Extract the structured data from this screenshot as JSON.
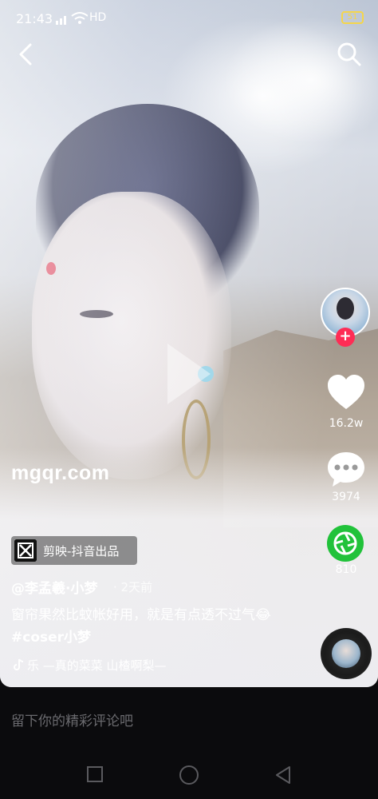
{
  "status_bar": {
    "time": "21:43",
    "network": "HD",
    "battery": "51"
  },
  "watermark": "mgqr.com",
  "capcut": {
    "label": "剪映-抖音出品"
  },
  "post": {
    "author": "@李孟羲·小梦",
    "time_ago": "· 2天前",
    "caption_text": "窗帘果然比蚊帐好用，就是有点透不过气😂 ",
    "hashtag": "#coser小梦",
    "music": "乐 —真的菜菜    山楂啊梨—"
  },
  "actions": {
    "likes": "16.2w",
    "comments": "3974",
    "shares": "810",
    "follow_symbol": "+"
  },
  "comment_input": {
    "placeholder": "留下你的精彩评论吧"
  },
  "colors": {
    "like_red": "#fe2c55",
    "share_green": "#21c23a",
    "battery_yellow": "#f5d64a"
  }
}
